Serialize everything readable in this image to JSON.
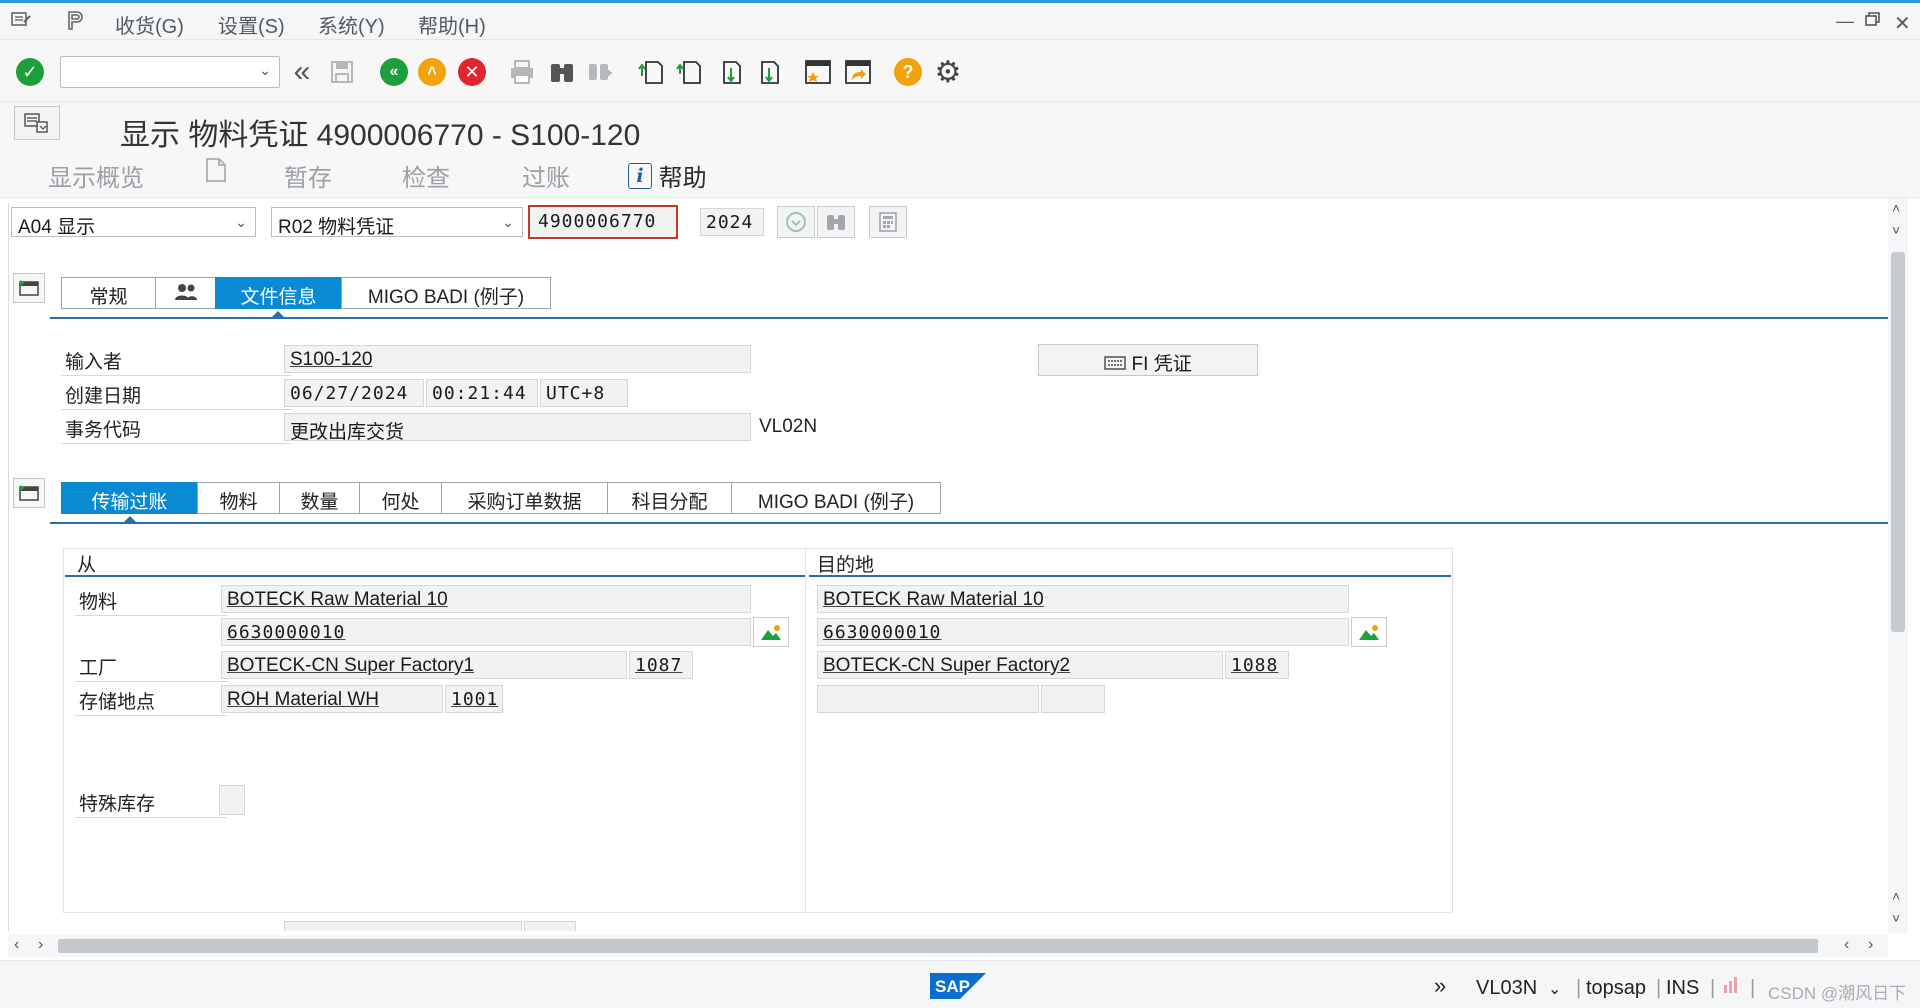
{
  "menu": {
    "items": [
      "收货(G)",
      "设置(S)",
      "系统(Y)",
      "帮助(H)"
    ]
  },
  "toolbar": {
    "command_value": "",
    "icons": [
      "enter-icon",
      "back-double-icon",
      "save-icon",
      "back-icon",
      "exit-icon",
      "cancel-icon",
      "print-icon",
      "find-icon",
      "find-next-icon",
      "first-page-icon",
      "prev-page-icon",
      "next-page-icon",
      "last-page-icon",
      "create-session-icon",
      "shortcut-icon",
      "help-icon",
      "settings-icon"
    ],
    "colors": {
      "enter": "#1f9e3c",
      "back": "#1f9e3c",
      "exit": "#f2a20c",
      "cancel": "#e0262d",
      "help": "#f2a20c"
    }
  },
  "title": "显示 物料凭证 4900006770 - S100-120",
  "app_toolbar": {
    "overview": "显示概览",
    "hold": "暂存",
    "check": "检查",
    "post": "过账",
    "help": "帮助"
  },
  "header_row": {
    "action": "A04 显示",
    "reference": "R02 物料凭证",
    "doc_number": "4900006770",
    "year": "2024"
  },
  "header_tabs": {
    "general": "常规",
    "doc_info": "文件信息",
    "badi": "MIGO BADI (例子)"
  },
  "doc_info": {
    "entered_by_label": "输入者",
    "entered_by": "S100-120",
    "created_label": "创建日期",
    "created_date": "06/27/2024",
    "created_time": "00:21:44",
    "timezone": "UTC+8",
    "tcode_label": "事务代码",
    "tcode_text": "更改出库交货",
    "tcode": "VL02N",
    "fi_button": "FI 凭证"
  },
  "item_tabs": [
    "传输过账",
    "物料",
    "数量",
    "何处",
    "采购订单数据",
    "科目分配",
    "MIGO BADI (例子)"
  ],
  "from": {
    "title": "从",
    "material_label": "物料",
    "material_desc": "BOTECK Raw Material 10",
    "material_no": "6630000010",
    "plant_label": "工厂",
    "plant_desc": "BOTECK-CN Super Factory1",
    "plant_code": "1087",
    "sloc_label": "存储地点",
    "sloc_desc": "ROH Material WH",
    "sloc_code": "1001",
    "special_stock_label": "特殊库存"
  },
  "to": {
    "title": "目的地",
    "material_desc": "BOTECK Raw Material 10",
    "material_no": "6630000010",
    "plant_desc": "BOTECK-CN Super Factory2",
    "plant_code": "1088"
  },
  "status": {
    "tcode": "VL03N",
    "server": "topsap",
    "mode": "INS",
    "watermark": "CSDN @潮风日下"
  }
}
